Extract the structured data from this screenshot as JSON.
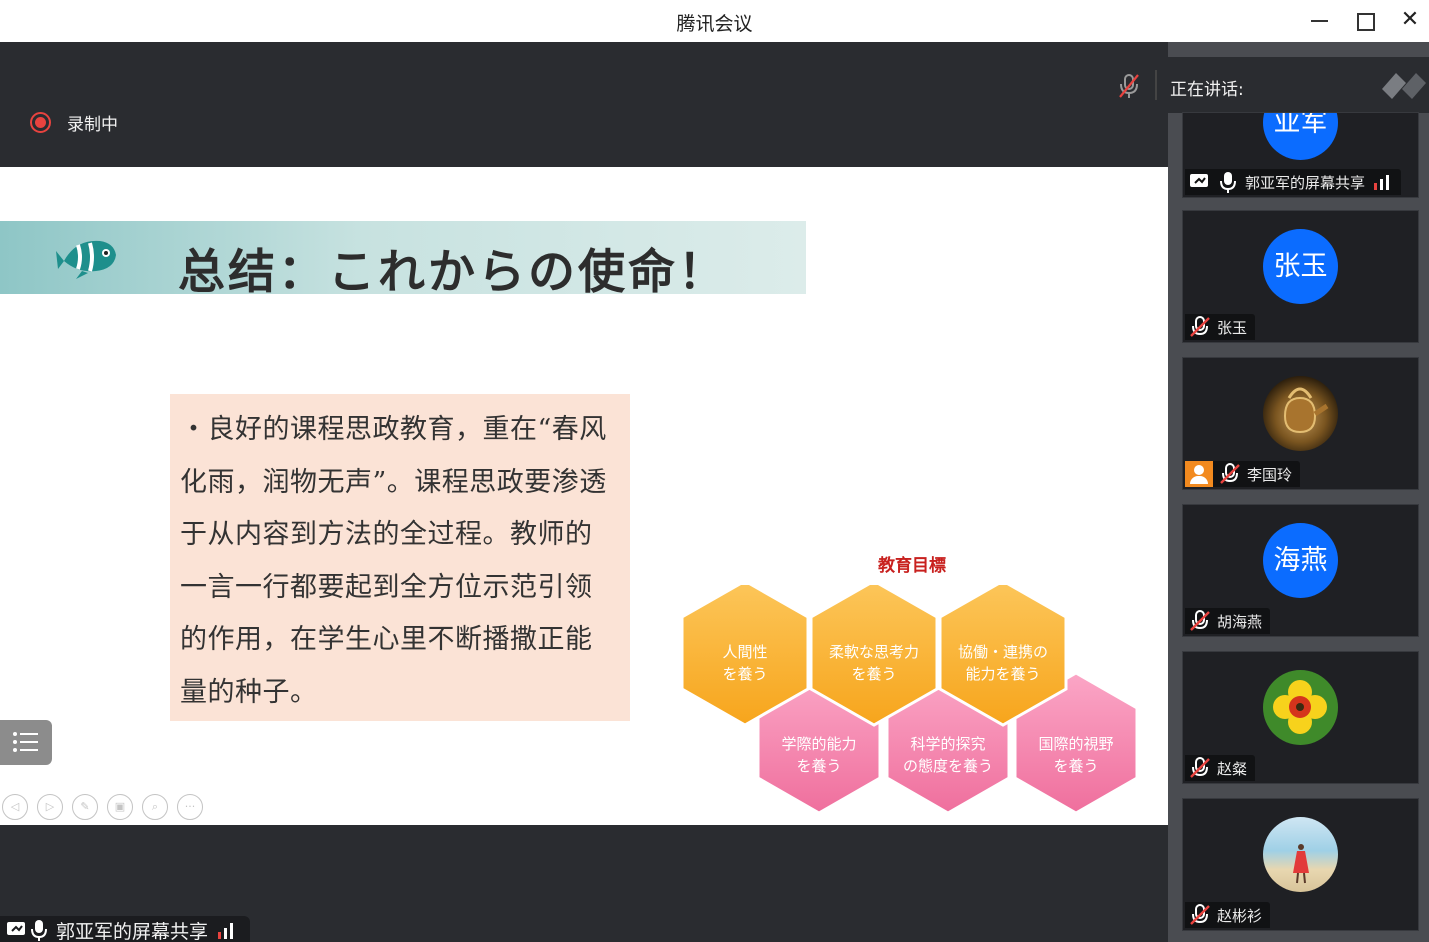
{
  "window": {
    "title": "腾讯会议"
  },
  "recording": {
    "label": "录制中"
  },
  "speaking": {
    "label": "正在讲话:"
  },
  "slide": {
    "title": "总结：これからの使命！",
    "body": "・良好的课程思政教育，重在“春风化雨，润物无声”。课程思政要渗透于从内容到方法的全过程。教师的一言一行都要起到全方位示范引领的作用，在学生心里不断播撒正能量的种子。",
    "diagram_title": "教育目標",
    "hexagons": [
      {
        "line1": "人間性",
        "line2": "を養う",
        "color": "#f9b233"
      },
      {
        "line1": "柔軟な思考力",
        "line2": "を養う",
        "color": "#f9b233"
      },
      {
        "line1": "協働・連携の",
        "line2": "能力を養う",
        "color": "#f9b233"
      },
      {
        "line1": "学際的能力",
        "line2": "を養う",
        "color": "#f27aa6"
      },
      {
        "line1": "科学的探究",
        "line2": "の態度を養う",
        "color": "#f27aa6"
      },
      {
        "line1": "国際的視野",
        "line2": "を養う",
        "color": "#f27aa6"
      }
    ]
  },
  "share_tag": {
    "label": "郭亚军的屏幕共享"
  },
  "participants": [
    {
      "name": "郭亚军的屏幕共享",
      "avatar_text": "业军",
      "avatar_color": "#0b6cff",
      "mic": "on",
      "sharing": true
    },
    {
      "name": "张玉",
      "avatar_text": "张玉",
      "avatar_color": "#0b6cff",
      "mic": "muted"
    },
    {
      "name": "李国玲",
      "avatar_text": "",
      "avatar_picture": "teapot",
      "mic": "muted",
      "host": true
    },
    {
      "name": "胡海燕",
      "avatar_text": "海燕",
      "avatar_color": "#0b6cff",
      "mic": "muted"
    },
    {
      "name": "赵粲",
      "avatar_text": "",
      "avatar_picture": "flower",
      "mic": "muted"
    },
    {
      "name": "赵彬衫",
      "avatar_text": "",
      "avatar_picture": "beach",
      "mic": "muted"
    }
  ]
}
